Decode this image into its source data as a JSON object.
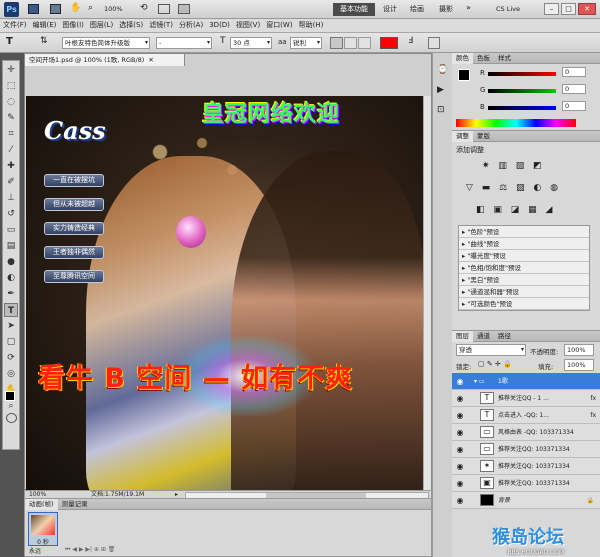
{
  "app": {
    "logo": "Ps",
    "zoom": "100%",
    "workspaces": [
      "基本功能",
      "设计",
      "绘画",
      "摄影"
    ],
    "cslive": "CS Live"
  },
  "menu": [
    "文件(F)",
    "编辑(E)",
    "图像(I)",
    "图层(L)",
    "选择(S)",
    "滤镜(T)",
    "分析(A)",
    "3D(D)",
    "视图(V)",
    "窗口(W)",
    "帮助(H)"
  ],
  "options": {
    "font_family": "叶根友特色简体升级版",
    "font_style": "-",
    "font_size": "30 点",
    "aa_label": "aa",
    "aa_mode": "锐利",
    "text_color": "#ff0000"
  },
  "document": {
    "tab": "空间开场1.psd @ 100% (1歌, RGB/8)",
    "zoom": "100%",
    "doc_info": "文档:1.75M/19.1M"
  },
  "canvas": {
    "brand": "Cass",
    "banner": "皇冠网络欢迎",
    "buttons": [
      "一直在被摆坑",
      "但从未被超越",
      "实力铸造经典",
      "王者独非偶然",
      "至尊腾讯空间"
    ],
    "slogan": "看牛 B 空间 — 如有不爽"
  },
  "color_panel": {
    "tabs": [
      "颜色",
      "色板",
      "样式"
    ],
    "r_label": "R",
    "g_label": "G",
    "b_label": "B",
    "r": "0",
    "g": "0",
    "b": "0"
  },
  "adjust_panel": {
    "tabs": [
      "调整",
      "蒙版"
    ],
    "title": "添加调整",
    "presets": [
      "\"色阶\"预设",
      "\"曲线\"预设",
      "\"曝光度\"预设",
      "\"色相/饱和度\"预设",
      "\"黑白\"预设",
      "\"通道混和器\"预设",
      "\"可选颜色\"预设"
    ]
  },
  "layers_panel": {
    "tabs": [
      "图层",
      "通道",
      "路径"
    ],
    "blend": "穿透",
    "opacity_label": "不透明度:",
    "opacity": "100%",
    "lock_label": "锁定:",
    "fill_label": "填充:",
    "fill": "100%",
    "layers": [
      {
        "name": "1歌",
        "thumb": "▭",
        "fx": ""
      },
      {
        "name": "推荐关注QQ - 1 ...",
        "thumb": "T",
        "fx": "fx"
      },
      {
        "name": "点击进入 -QQ: 1...",
        "thumb": "T",
        "fx": "fx"
      },
      {
        "name": "风格由表 -QQ: 103371334",
        "thumb": "▭",
        "fx": ""
      },
      {
        "name": "推荐关注QQ: 103371334",
        "thumb": "▭",
        "fx": ""
      },
      {
        "name": "推荐关注QQ: 103371334",
        "thumb": "✶",
        "fx": ""
      },
      {
        "name": "推荐关注QQ: 103371334",
        "thumb": "▣",
        "fx": ""
      },
      {
        "name": "背景",
        "thumb": "■",
        "fx": ""
      }
    ]
  },
  "anim_panel": {
    "tabs": [
      "动画(帧)",
      "测量记录"
    ],
    "frame_time": "0 秒",
    "loop": "永远"
  },
  "watermark": {
    "line1": "猴岛论坛",
    "line2": "BBS.HOUDAO.COM"
  }
}
